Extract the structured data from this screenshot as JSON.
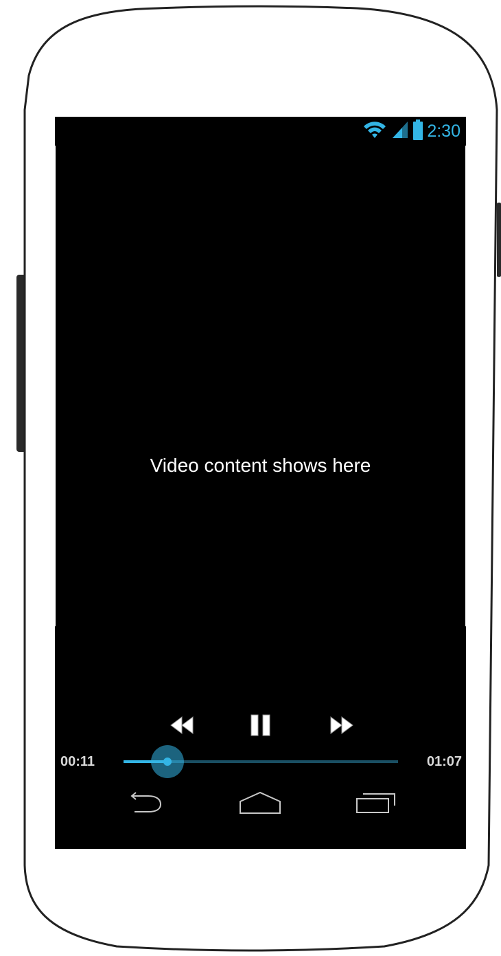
{
  "status_bar": {
    "time": "2:30",
    "icons": [
      "wifi-icon",
      "signal-icon",
      "battery-icon"
    ],
    "accent_color": "#33b5e5"
  },
  "video": {
    "placeholder_text": "Video content shows here"
  },
  "player": {
    "elapsed": "00:11",
    "duration": "01:07",
    "progress_fraction": 0.16,
    "buttons": [
      "rewind-icon",
      "pause-icon",
      "fast-forward-icon"
    ],
    "seek_color": "#33b5e5"
  },
  "nav_bar": {
    "buttons": [
      "back-icon",
      "home-icon",
      "recent-apps-icon"
    ]
  }
}
